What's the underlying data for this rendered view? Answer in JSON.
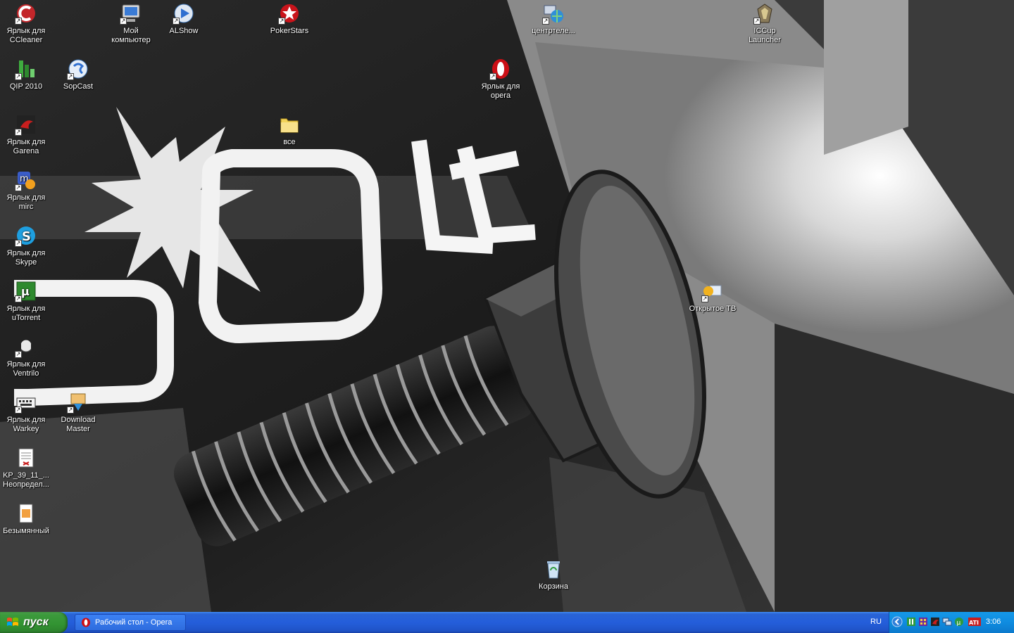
{
  "desktop": {
    "icons": [
      {
        "name": "ccleaner-shortcut",
        "label": "Ярлык для CCleaner"
      },
      {
        "name": "my-computer",
        "label": "Мой компьютер"
      },
      {
        "name": "alshow-shortcut",
        "label": "ALShow"
      },
      {
        "name": "pokerstars-shortcut",
        "label": "PokerStars"
      },
      {
        "name": "centrtele-shortcut",
        "label": "центртеле..."
      },
      {
        "name": "iccup-launcher-shortcut",
        "label": "ICCup Launcher"
      },
      {
        "name": "qip-shortcut",
        "label": "QIP 2010"
      },
      {
        "name": "sopcast-shortcut",
        "label": "SopCast"
      },
      {
        "name": "opera-shortcut",
        "label": "Ярлык для opera"
      },
      {
        "name": "garena-shortcut",
        "label": "Ярлык для Garena"
      },
      {
        "name": "vse-folder",
        "label": "все"
      },
      {
        "name": "mirc-shortcut",
        "label": "Ярлык для mirc"
      },
      {
        "name": "skype-shortcut",
        "label": "Ярлык для Skype"
      },
      {
        "name": "utorrent-shortcut",
        "label": "Ярлык для uTorrent"
      },
      {
        "name": "otkrytoe-tv-shortcut",
        "label": "Открытое ТВ"
      },
      {
        "name": "ventrilo-shortcut",
        "label": "Ярлык для Ventrilo"
      },
      {
        "name": "warkey-shortcut",
        "label": "Ярлык для Warkey"
      },
      {
        "name": "download-master-shortcut",
        "label": "Download Master"
      },
      {
        "name": "kp-document",
        "label": "KP_39_11_... Неопредел..."
      },
      {
        "name": "bezymyannyj-file",
        "label": "Безымянный"
      },
      {
        "name": "recycle-bin",
        "label": "Корзина"
      }
    ]
  },
  "taskbar": {
    "start_label": "пуск",
    "tasks": [
      {
        "label": "Рабочий стол - Opera"
      }
    ],
    "language": "RU",
    "clock": "3:06"
  },
  "colors": {
    "taskbar_blue": "#245edb",
    "start_green": "#3b9a3b",
    "tray_blue": "#0f8ce0",
    "opera_red": "#cc0f16"
  }
}
